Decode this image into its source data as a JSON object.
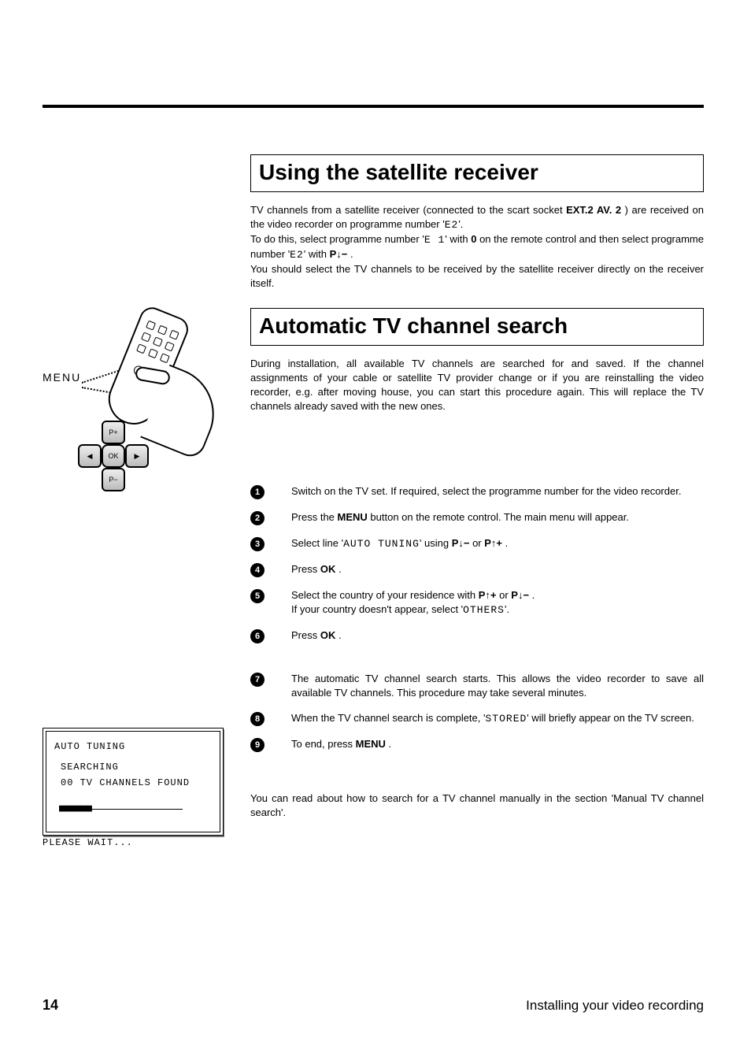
{
  "sections": {
    "satellite": {
      "title": "Using the satellite receiver",
      "para_a": "TV channels from a satellite receiver (connected to the scart socket ",
      "scart_label": "EXT.2 AV. 2",
      "para_b": " ) are received on the video recorder on programme number '",
      "prog_e2": "E2",
      "para_c": "'.",
      "para_d": "To do this, select programme number '",
      "prog_e1": "E 1",
      "para_e": "' with ",
      "zero_key": "0",
      "para_f": " on the remote control and then select programme number '",
      "para_g": "' with ",
      "pdown": "P↓−",
      "para_h": " .",
      "para_i": "You should select the TV channels to be received by the satellite receiver directly on the receiver itself."
    },
    "auto": {
      "title": "Automatic TV channel search",
      "intro": "During installation, all available TV channels are searched for and saved. If the channel assignments of your cable or satellite TV provider change or if you are reinstalling the video recorder, e.g. after moving house, you can start this procedure again. This will replace the TV channels already saved with the new ones."
    }
  },
  "remote": {
    "label": "MENU",
    "dpad": {
      "up": "P+",
      "down": "P−",
      "left": "◀",
      "right": "▶",
      "ok": "OK"
    }
  },
  "steps": [
    {
      "n": "1",
      "pre": "Switch on the TV set. If required, select the programme number for the video recorder."
    },
    {
      "n": "2",
      "pre": "Press the ",
      "b1": "MENU",
      "post": " button on the remote control. The main menu will appear."
    },
    {
      "n": "3",
      "pre": "Select line '",
      "mono": "AUTO TUNING",
      "mid": "' using ",
      "b1": "P↓−",
      "or": " or ",
      "b2": "P↑+",
      "post": " ."
    },
    {
      "n": "4",
      "pre": "Press ",
      "b1": "OK",
      "post": " ."
    },
    {
      "n": "5",
      "pre": "Select the country of your residence with ",
      "b1": "P↑+",
      "or": " or ",
      "b2": "P↓−",
      "post": " .",
      "line2a": "If your country doesn't appear, select '",
      "line2mono": "OTHERS",
      "line2b": "'."
    },
    {
      "n": "6",
      "pre": "Press ",
      "b1": "OK",
      "post": " ."
    },
    {
      "n": "7",
      "pre": "The automatic TV channel search starts. This allows the video recorder to save all available TV channels. This procedure may take several minutes."
    },
    {
      "n": "8",
      "pre": "When the TV channel search is complete, '",
      "mono": "STORED",
      "post": "' will briefly appear on the TV screen."
    },
    {
      "n": "9",
      "pre": "To end, press ",
      "b1": "MENU",
      "post": " ."
    }
  ],
  "screen": {
    "line1": "AUTO TUNING",
    "line2": "SEARCHING",
    "line3": "00 TV CHANNELS FOUND",
    "blocks": "■■■■■■",
    "wait": "PLEASE WAIT..."
  },
  "closing": "You can read about how to search for a TV channel manually in the section 'Manual TV channel search'.",
  "footer": {
    "page": "14",
    "title": "Installing your video recording"
  }
}
